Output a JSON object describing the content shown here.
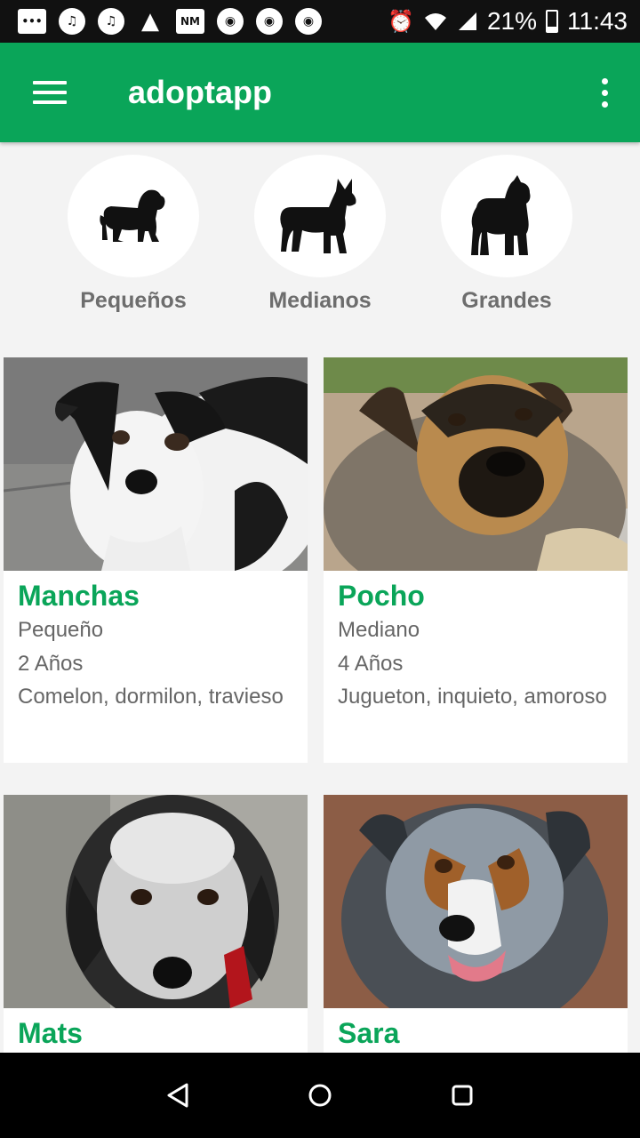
{
  "status_bar": {
    "battery": "21%",
    "time": "11:43",
    "icons": [
      "messages-icon",
      "music-icon",
      "music-icon",
      "drive-icon",
      "nm-icon",
      "chrome-icon",
      "chrome-icon",
      "chrome-icon",
      "alarm-icon",
      "wifi-icon",
      "signal-icon",
      "battery-icon"
    ]
  },
  "app_bar": {
    "title": "adoptapp",
    "color": "#0aa559"
  },
  "categories": [
    {
      "label": "Pequeños",
      "icon": "small-dog-icon"
    },
    {
      "label": "Medianos",
      "icon": "medium-dog-icon"
    },
    {
      "label": "Grandes",
      "icon": "large-dog-icon"
    }
  ],
  "dogs": [
    {
      "name": "Manchas",
      "size": "Pequeño",
      "age": "2 Años",
      "traits": "Comelon, dormilon, travieso"
    },
    {
      "name": "Pocho",
      "size": "Mediano",
      "age": "4 Años",
      "traits": "Jugueton, inquieto, amoroso"
    },
    {
      "name": "Mats",
      "size": "",
      "age": "",
      "traits": ""
    },
    {
      "name": "Sara",
      "size": "",
      "age": "",
      "traits": ""
    }
  ],
  "nav_bar": {
    "buttons": [
      "back-icon",
      "home-icon",
      "recents-icon"
    ]
  }
}
